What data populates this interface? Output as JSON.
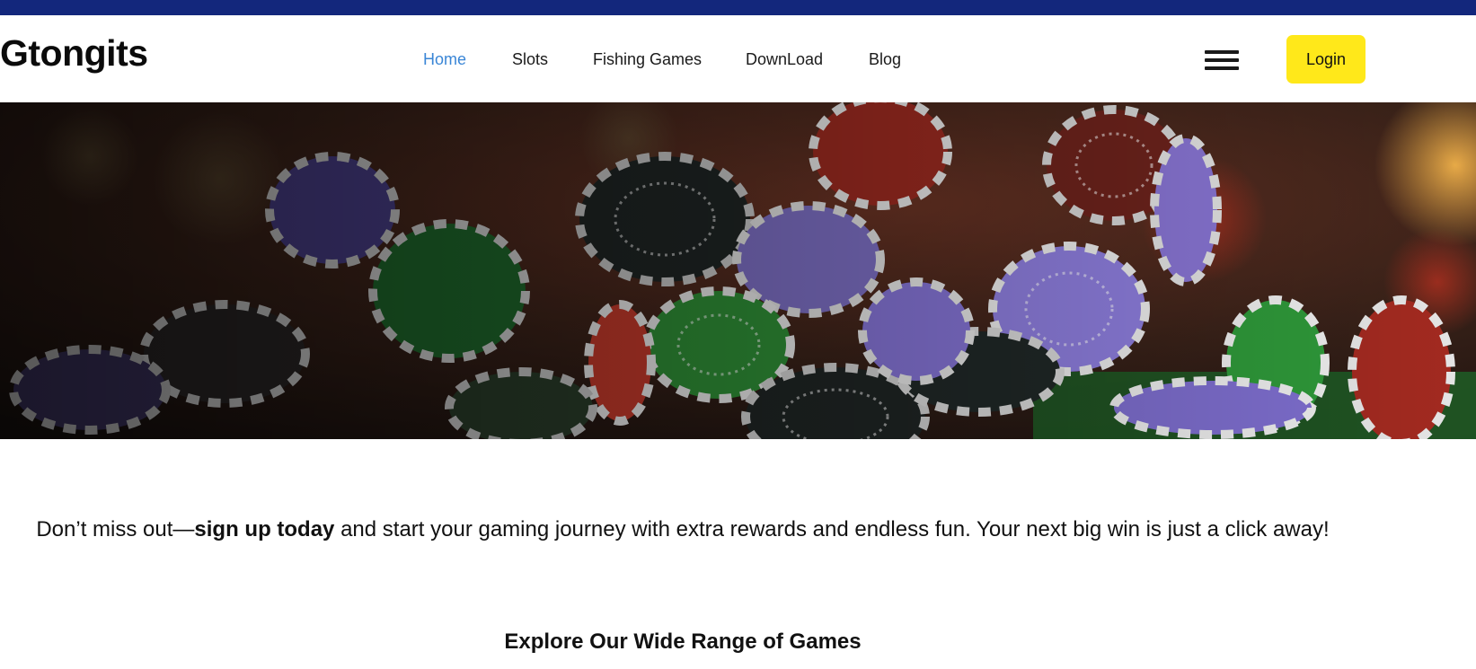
{
  "brand": {
    "name": "Gtongits"
  },
  "nav": {
    "items": [
      {
        "label": "Home",
        "active": true
      },
      {
        "label": "Slots",
        "active": false
      },
      {
        "label": "Fishing Games",
        "active": false
      },
      {
        "label": "DownLoad",
        "active": false
      },
      {
        "label": "Blog",
        "active": false
      }
    ],
    "menu_icon": "hamburger-menu-icon"
  },
  "header": {
    "login_label": "Login"
  },
  "hero": {
    "image": "casino-poker-chips-photo"
  },
  "promo": {
    "prefix": "Don’t miss out—",
    "bold": "sign up today",
    "suffix": " and start your gaming journey with extra rewards and endless fun. Your next big win is just a click away!"
  },
  "section": {
    "title": "Explore Our Wide Range of Games"
  },
  "colors": {
    "top_strip": "#13277c",
    "nav_active": "#3a86d6",
    "login_bg": "#ffe81a",
    "text": "#111111"
  }
}
